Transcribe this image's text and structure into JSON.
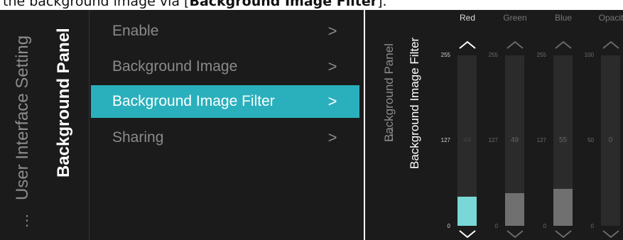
{
  "caption": {
    "prefix": "the background image via [",
    "bold": "Background Image Filter",
    "suffix": "]."
  },
  "left": {
    "crumb_parent": "User Interface Setting",
    "crumb_current": "Background Panel",
    "dots": "⋮",
    "menu": [
      {
        "label": "Enable",
        "chevron": ">"
      },
      {
        "label": "Background Image",
        "chevron": ">"
      },
      {
        "label": "Background Image Filter",
        "chevron": ">",
        "selected": true
      },
      {
        "label": "Sharing",
        "chevron": ">"
      }
    ]
  },
  "right": {
    "crumb_parent": "Background Panel",
    "crumb_current": "Background Image Filter",
    "dots": "⋮",
    "sliders": [
      {
        "label": "Red",
        "max": "255",
        "mid": "127",
        "min": "0",
        "value": "44",
        "value_num": 44,
        "range_max": 255,
        "active": true
      },
      {
        "label": "Green",
        "max": "255",
        "mid": "127",
        "min": "0",
        "value": "49",
        "value_num": 49,
        "range_max": 255
      },
      {
        "label": "Blue",
        "max": "255",
        "mid": "127",
        "min": "0",
        "value": "55",
        "value_num": 55,
        "range_max": 255
      },
      {
        "label": "Opacit",
        "max": "100",
        "mid": "50",
        "min": "0",
        "value": "0",
        "value_num": 0,
        "range_max": 100
      }
    ]
  },
  "colors": {
    "accent": "#2ab0bc",
    "fill_active": "#7ad7d7",
    "background": "#1b1b1b"
  }
}
